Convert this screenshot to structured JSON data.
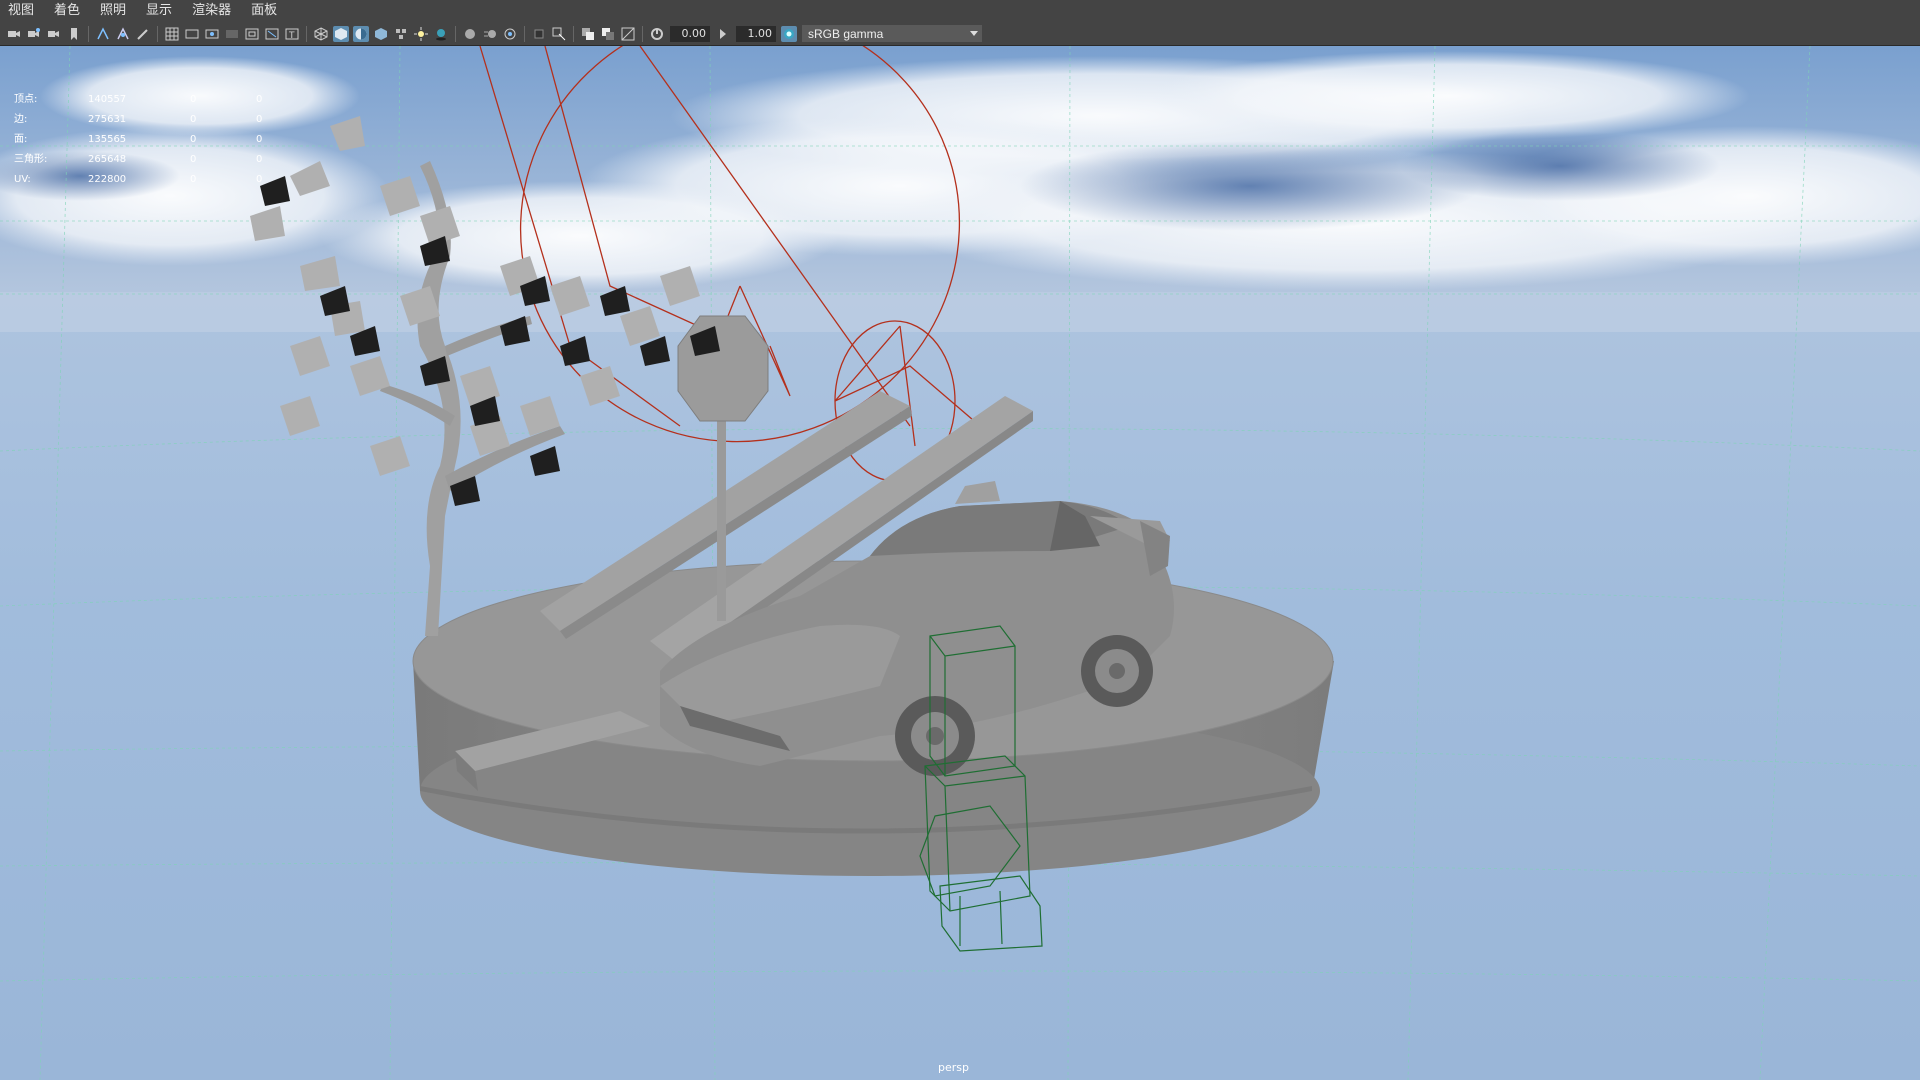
{
  "menu": [
    "视图",
    "着色",
    "照明",
    "显示",
    "渲染器",
    "面板"
  ],
  "toolbar": {
    "exposure": "0.00",
    "gamma": "1.00",
    "color_space": "sRGB gamma",
    "icons": [
      "camera-icon",
      "camera-attr-icon",
      "bookmark-icon",
      "image-plane-icon",
      "grid-icon",
      "film-gate-icon",
      "resolution-gate-icon",
      "safe-action-icon",
      "wireframe-icon",
      "smooth-shade-icon",
      "textured-icon",
      "lights-icon",
      "shadows-icon",
      "ambient-occlusion-icon",
      "motion-blur-icon",
      "isolate-icon",
      "xray-icon",
      "exposure-icon",
      "gamma-icon",
      "colorspace-icon"
    ]
  },
  "hud": {
    "rows": [
      {
        "label": "顶点:",
        "v1": "140557",
        "v2": "0",
        "v3": "0"
      },
      {
        "label": "边:",
        "v1": "275631",
        "v2": "0",
        "v3": "0"
      },
      {
        "label": "面:",
        "v1": "135565",
        "v2": "0",
        "v3": "0"
      },
      {
        "label": "三角形:",
        "v1": "265648",
        "v2": "0",
        "v3": "0"
      },
      {
        "label": "UV:",
        "v1": "222800",
        "v2": "0",
        "v3": "0"
      }
    ]
  },
  "camera": "persp",
  "colors": {
    "panel_bg": "#444444",
    "sky_top": "#7fa3cf",
    "floor": "#a9c1de",
    "model_gray": "#8a8a8a",
    "light_manip": "#b4301c",
    "cage_green": "#1f6e33",
    "grid_line": "#7fd3b7",
    "active_icon": "#5d8db0"
  }
}
